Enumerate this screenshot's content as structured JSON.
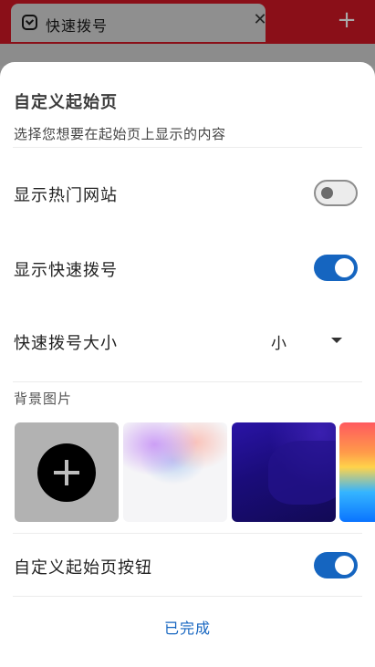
{
  "browser": {
    "tab_title": "快速拨号",
    "tab_close": "✕",
    "new_tab": "+"
  },
  "sheet": {
    "title": "自定义起始页",
    "subtitle": "选择您想要在起始页上显示的内容",
    "show_top_sites": {
      "label": "显示热门网站",
      "enabled": false
    },
    "show_speed_dial": {
      "label": "显示快速拨号",
      "enabled": true
    },
    "speed_dial_size": {
      "label": "快速拨号大小",
      "value": "小"
    },
    "background_section_label": "背景图片",
    "backgrounds": [
      "add-image",
      "soft-gradient",
      "deep-purple",
      "colorful"
    ],
    "custom_start_button": {
      "label": "自定义起始页按钮",
      "enabled": true
    },
    "done_label": "已完成"
  },
  "colors": {
    "accent": "#1565c0",
    "toolbar": "#8a0f18",
    "scrim": "#8f8f8f"
  }
}
